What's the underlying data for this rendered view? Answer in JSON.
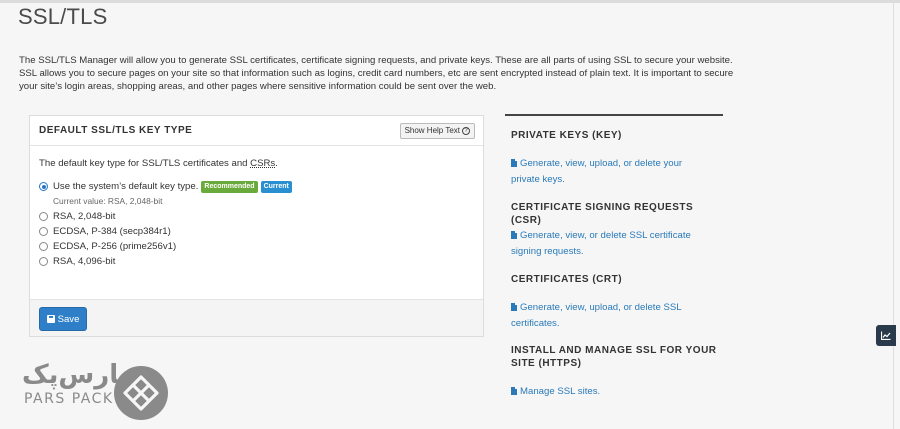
{
  "page": {
    "title": "SSL/TLS",
    "intro": "The SSL/TLS Manager will allow you to generate SSL certificates, certificate signing requests, and private keys. These are all parts of using SSL to secure your website. SSL allows you to secure pages on your site so that information such as logins, credit card numbers, etc are sent encrypted instead of plain text. It is important to secure your site’s login areas, shopping areas, and other pages where sensitive information could be sent over the web."
  },
  "panel": {
    "title": "DEFAULT SSL/TLS KEY TYPE",
    "help_button": "Show Help Text",
    "description_prefix": "The default key type for SSL/TLS certificates and ",
    "description_abbr": "CSRs",
    "description_suffix": ".",
    "options": [
      {
        "label": "Use the system’s default key type.",
        "checked": true
      },
      {
        "label": "RSA, 2,048-bit",
        "checked": false
      },
      {
        "label": "ECDSA, P-384 (secp384r1)",
        "checked": false
      },
      {
        "label": "ECDSA, P-256 (prime256v1)",
        "checked": false
      },
      {
        "label": "RSA, 4,096-bit",
        "checked": false
      }
    ],
    "badges": {
      "recommended": "Recommended",
      "current": "Current"
    },
    "current_value": "Current value: RSA, 2,048-bit",
    "save_label": "Save"
  },
  "sidebar": {
    "sections": [
      {
        "title": "PRIVATE KEYS (KEY)",
        "link_line1": "Generate, view, upload, or delete your",
        "link_line2": "private keys."
      },
      {
        "title": "CERTIFICATE SIGNING REQUESTS (CSR)",
        "link_line1": "Generate, view, or delete SSL certificate",
        "link_line2": "signing requests."
      },
      {
        "title": "CERTIFICATES (CRT)",
        "link_line1": "Generate, view, upload, or delete SSL",
        "link_line2": "certificates."
      },
      {
        "title_line1": "INSTALL AND MANAGE SSL FOR YOUR",
        "title_line2": "SITE (HTTPS)",
        "link": "Manage SSL sites."
      }
    ]
  },
  "logo": {
    "persian": "پارس‌پک",
    "english": "PARS PACK"
  },
  "colors": {
    "link": "#2a7ab8",
    "primary_button": "#2f7fc8",
    "badge_recommended": "#6aaa3a",
    "badge_current": "#2a8fd0",
    "chart_tab": "#293a4a"
  },
  "icons": {
    "help": "question-circle-icon",
    "save": "floppy-icon",
    "link": "document-icon",
    "chart_tab": "line-chart-icon"
  }
}
